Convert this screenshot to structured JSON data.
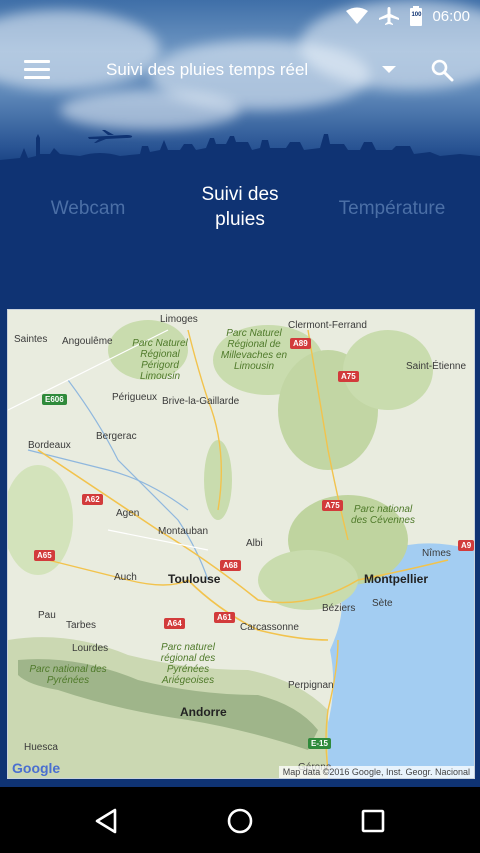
{
  "status_bar": {
    "time": "06:00",
    "battery_level": "100",
    "icons": [
      "wifi-icon",
      "airplane-icon",
      "battery-icon"
    ]
  },
  "toolbar": {
    "title": "Suivi des pluies temps réel",
    "icons": [
      "menu-icon",
      "dropdown-icon",
      "search-icon"
    ]
  },
  "tabs": [
    {
      "label": "Webcam",
      "active": false
    },
    {
      "label": "Suivi des pluies",
      "active": true
    },
    {
      "label": "Température",
      "active": false
    }
  ],
  "map": {
    "cities": [
      {
        "name": "Limoges",
        "weight": "normal"
      },
      {
        "name": "Clermont-Ferrand",
        "weight": "normal"
      },
      {
        "name": "Saintes",
        "weight": "normal"
      },
      {
        "name": "Angoulême",
        "weight": "normal"
      },
      {
        "name": "Saint-Étienne",
        "weight": "normal"
      },
      {
        "name": "Périgueux",
        "weight": "normal"
      },
      {
        "name": "Brive-la-Gaillarde",
        "weight": "normal"
      },
      {
        "name": "Bordeaux",
        "weight": "normal"
      },
      {
        "name": "Bergerac",
        "weight": "normal"
      },
      {
        "name": "Agen",
        "weight": "normal"
      },
      {
        "name": "Montauban",
        "weight": "normal"
      },
      {
        "name": "Albi",
        "weight": "normal"
      },
      {
        "name": "Nîmes",
        "weight": "normal"
      },
      {
        "name": "Auch",
        "weight": "normal"
      },
      {
        "name": "Toulouse",
        "weight": "bold"
      },
      {
        "name": "Montpellier",
        "weight": "bold"
      },
      {
        "name": "Pau",
        "weight": "normal"
      },
      {
        "name": "Tarbes",
        "weight": "normal"
      },
      {
        "name": "Carcassonne",
        "weight": "normal"
      },
      {
        "name": "Béziers",
        "weight": "normal"
      },
      {
        "name": "Sète",
        "weight": "normal"
      },
      {
        "name": "Lourdes",
        "weight": "normal"
      },
      {
        "name": "Perpignan",
        "weight": "normal"
      },
      {
        "name": "Andorre",
        "weight": "bold"
      },
      {
        "name": "Huesca",
        "weight": "normal"
      },
      {
        "name": "Gérone",
        "weight": "normal"
      }
    ],
    "parks": [
      "Parc Naturel Régional Périgord Limousin",
      "Parc Naturel Régional de Millevaches en Limousin",
      "Parc national des Cévennes",
      "Parc naturel régional des Pyrénées Ariégeoises",
      "Parc national des Pyrénées"
    ],
    "roads": [
      "A89",
      "E606",
      "A75",
      "A62",
      "A75",
      "A65",
      "A68",
      "A9",
      "A64",
      "A61",
      "E-15"
    ],
    "logo": "Google",
    "credit": "Map data ©2016 Google, Inst. Geogr. Nacional"
  },
  "nav_bar": {
    "buttons": [
      "back-icon",
      "home-icon",
      "recents-icon"
    ]
  },
  "colors": {
    "background": "#0f3373",
    "tab_active": "#ffffff",
    "tab_inactive": "#4b6fa6",
    "sea": "#a3cdf2"
  }
}
